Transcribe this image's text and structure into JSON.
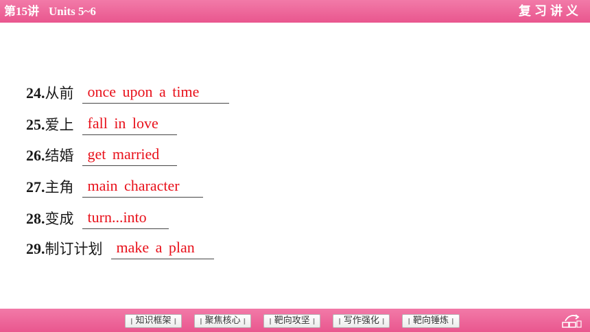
{
  "header": {
    "lesson": "第15讲",
    "units": "Units 5~6",
    "section": "复习讲义"
  },
  "items": [
    {
      "number": "24.",
      "chinese": "从前",
      "answer": "once  upon  a  time"
    },
    {
      "number": "25.",
      "chinese": "爱上",
      "answer": "fall  in  love"
    },
    {
      "number": "26.",
      "chinese": "结婚",
      "answer": "get  married"
    },
    {
      "number": "27.",
      "chinese": "主角",
      "answer": "main  character"
    },
    {
      "number": "28.",
      "chinese": "变成",
      "answer": "turn...into"
    },
    {
      "number": "29.",
      "chinese": "制订计划",
      "answer": "make  a  plan"
    }
  ],
  "nav": {
    "buttons": [
      "知识框架",
      "聚焦核心",
      "靶向攻坚",
      "写作强化",
      "靶向锤炼"
    ]
  },
  "page_icon": "page-forward-icon",
  "colors": {
    "bar": "#e9568e",
    "answer": "#e8101a"
  }
}
